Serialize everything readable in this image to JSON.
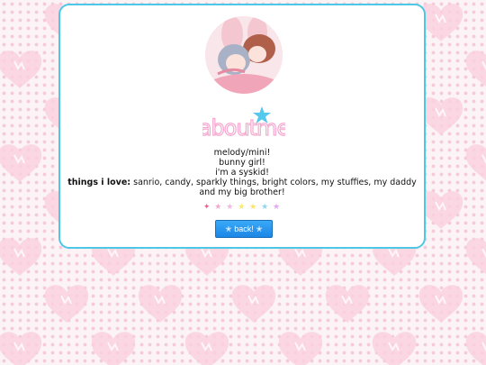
{
  "title_logo": {
    "text": "aboutme",
    "main_color": "#f7a8cf",
    "star_color": "#55c8ee"
  },
  "bio": {
    "line1": "melody/mini!",
    "line2": "bunny girl!",
    "line3": "i'm a syskid!",
    "loves_label": "things i love:",
    "loves_text": " sanrio, candy, sparkly things, bright colors, my stuffies, my daddy and my big brother!"
  },
  "star_divider": [
    {
      "glyph": "✦",
      "color": "#f06090"
    },
    {
      "glyph": "★",
      "color": "#f7a8cf"
    },
    {
      "glyph": "★",
      "color": "#f2b8e0"
    },
    {
      "glyph": "★",
      "color": "#f7ec6a"
    },
    {
      "glyph": "★",
      "color": "#ffe26a"
    },
    {
      "glyph": "★",
      "color": "#8fd9f2"
    },
    {
      "glyph": "★",
      "color": "#e2a8f0"
    }
  ],
  "back_button": {
    "label": "back!",
    "star": "✭"
  },
  "colors": {
    "card_border": "#4dc7e6",
    "background": "#fbf3f6",
    "heart": "#fad0df",
    "button": "#1c86e6"
  }
}
